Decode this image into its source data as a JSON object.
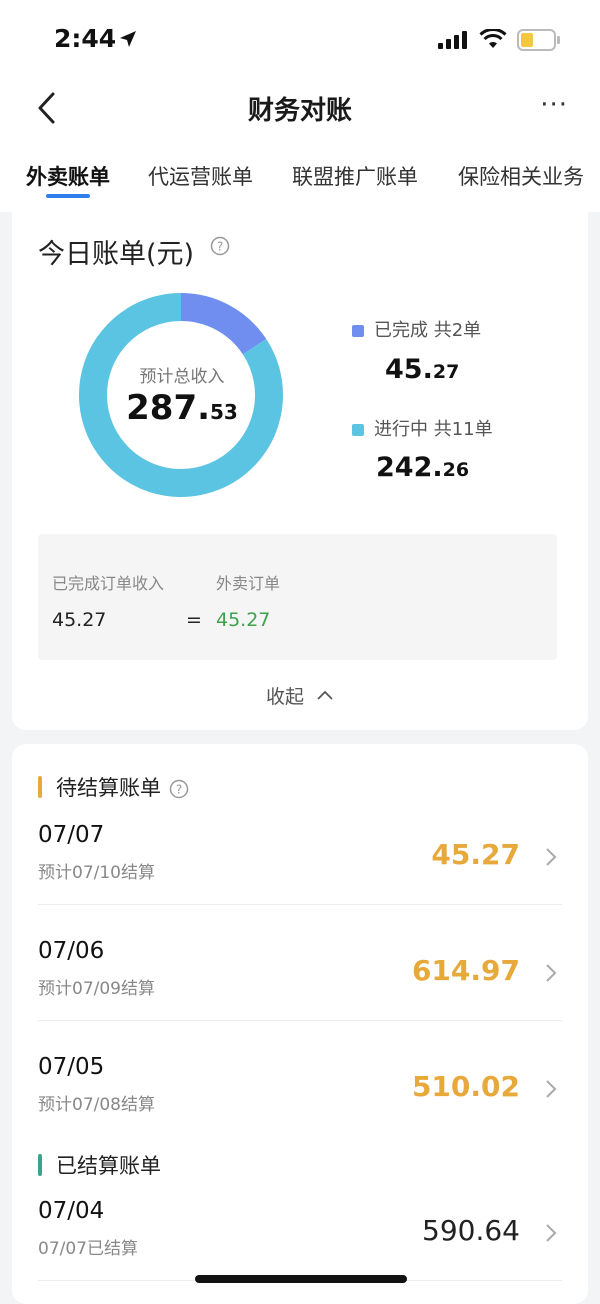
{
  "status": {
    "time": "2:44"
  },
  "nav": {
    "title": "财务对账",
    "more": "···"
  },
  "tabs": [
    {
      "label": "外卖账单",
      "active": true
    },
    {
      "label": "代运营账单",
      "active": false
    },
    {
      "label": "联盟推广账单",
      "active": false
    },
    {
      "label": "保险相关业务",
      "active": false
    }
  ],
  "today": {
    "title": "今日账单(元)",
    "center_label": "预计总收入",
    "total_int": "287.",
    "total_dec": "53",
    "legend": [
      {
        "label": "已完成  共2单",
        "int": "45.",
        "dec": "27",
        "color": "#6f8ef0"
      },
      {
        "label": "进行中  共11单",
        "int": "242.",
        "dec": "26",
        "color": "#5bc4e3"
      }
    ],
    "formula": {
      "left_label": "已完成订单收入",
      "left_value": "45.27",
      "equals": "=",
      "right_label": "外卖订单",
      "right_value": "45.27"
    },
    "collapse_label": "收起"
  },
  "chart_data": {
    "type": "pie",
    "categories": [
      "已完成",
      "进行中"
    ],
    "values": [
      45.27,
      242.26
    ],
    "colors": [
      "#6f8ef0",
      "#5bc4e3"
    ],
    "title": "",
    "donut": true
  },
  "pending": {
    "title": "待结算账单",
    "color": "#e8a93b",
    "items": [
      {
        "date": "07/07",
        "sub": "预计07/10结算",
        "amount": "45.27"
      },
      {
        "date": "07/06",
        "sub": "预计07/09结算",
        "amount": "614.97"
      },
      {
        "date": "07/05",
        "sub": "预计07/08结算",
        "amount": "510.02"
      }
    ]
  },
  "settled": {
    "title": "已结算账单",
    "color": "#3aa58f",
    "items": [
      {
        "date": "07/04",
        "sub": "07/07已结算",
        "amount": "590.64"
      }
    ]
  }
}
